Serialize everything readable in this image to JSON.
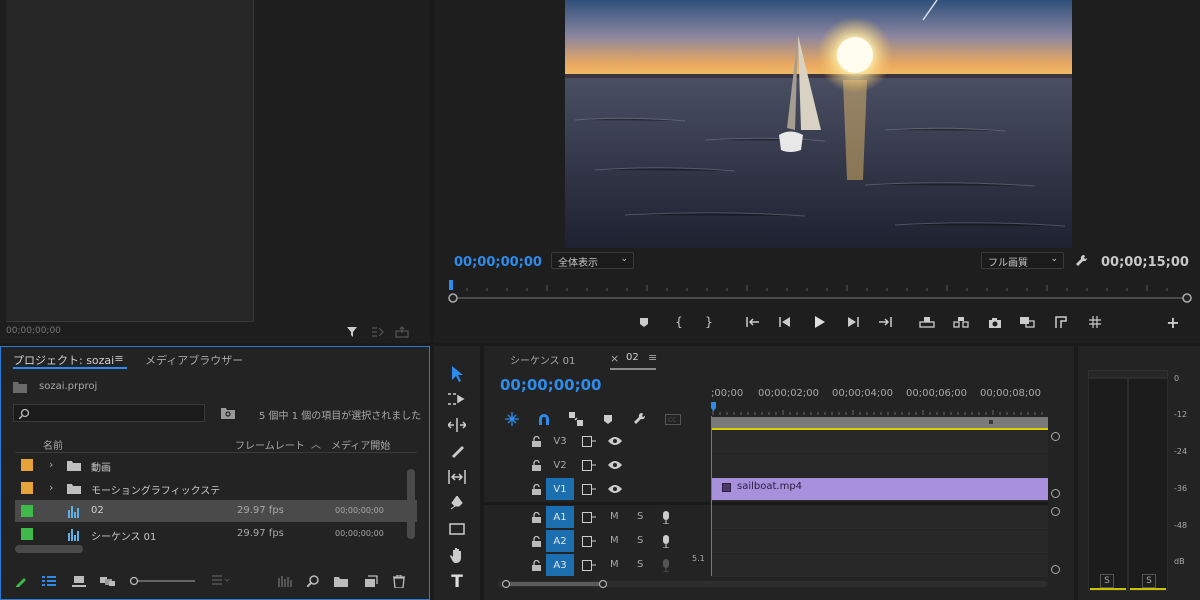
{
  "source": {
    "timecode": "00;00;00;00"
  },
  "program": {
    "timecode_in": "00;00;00;00",
    "timecode_out": "00;00;15;00",
    "zoom_select": "全体表示",
    "quality_select": "フル画質"
  },
  "project": {
    "tab_project": "プロジェクト: sozai",
    "tab_media_browser": "メディアブラウザー",
    "file_name": "sozai.prproj",
    "search_placeholder": "",
    "selection_status": "5 個中 1 個の項目が選択されました",
    "columns": {
      "name": "名前",
      "frame_rate": "フレームレート",
      "media_start": "メディア開始"
    },
    "items": [
      {
        "name": "動画",
        "type": "folder",
        "color": "#e8a23a",
        "frame_rate": "",
        "media_start": ""
      },
      {
        "name": "モーショングラフィックステ",
        "type": "folder",
        "color": "#e8a23a",
        "frame_rate": "",
        "media_start": ""
      },
      {
        "name": "02",
        "type": "sequence",
        "color": "#3fb94a",
        "frame_rate": "29.97 fps",
        "media_start": "00;00;00;00"
      },
      {
        "name": "シーケンス 01",
        "type": "sequence",
        "color": "#3fb94a",
        "frame_rate": "29.97 fps",
        "media_start": "00;00;00;00"
      }
    ]
  },
  "timeline": {
    "tab_seq01": "シーケンス 01",
    "tab_02": "02",
    "timecode": "00;00;00;00",
    "ruler": [
      ";00;00",
      "00;00;02;00",
      "00;00;04;00",
      "00;00;06;00",
      "00;00;08;00"
    ],
    "video_tracks": [
      "V3",
      "V2",
      "V1"
    ],
    "audio_tracks": [
      "A1",
      "A2",
      "A3"
    ],
    "clip_name": "sailboat.mp4",
    "mute_label": "M",
    "solo_label": "S",
    "channel_label": "5.1"
  },
  "meter": {
    "scale": [
      "0",
      "-12",
      "-24",
      "-36",
      "-48",
      "dB"
    ],
    "solo_left": "S",
    "solo_right": "S"
  },
  "colors": {
    "accent": "#2d8ceb",
    "clip": "#a990dd",
    "track_active": "#1b6fae",
    "folder": "#e8a23a",
    "sequence": "#3fb94a"
  }
}
